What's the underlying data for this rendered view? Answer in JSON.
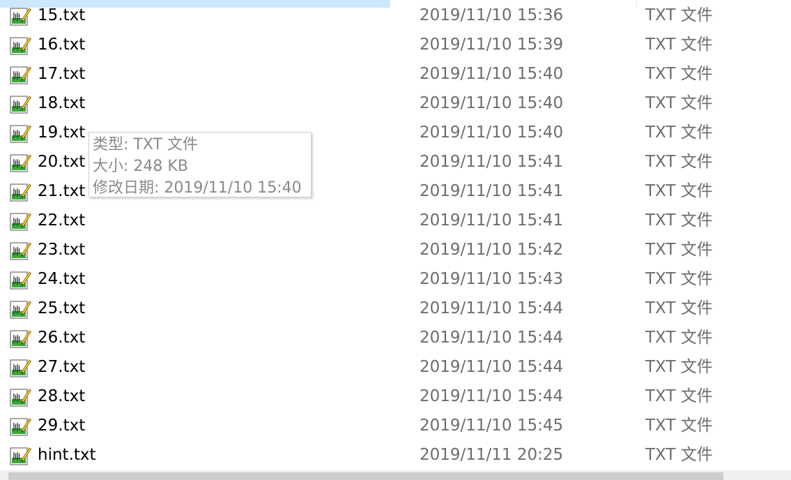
{
  "files": [
    {
      "name": "15.txt",
      "modified": "2019/11/10 15:36",
      "type": "TXT 文件"
    },
    {
      "name": "16.txt",
      "modified": "2019/11/10 15:39",
      "type": "TXT 文件"
    },
    {
      "name": "17.txt",
      "modified": "2019/11/10 15:40",
      "type": "TXT 文件"
    },
    {
      "name": "18.txt",
      "modified": "2019/11/10 15:40",
      "type": "TXT 文件"
    },
    {
      "name": "19.txt",
      "modified": "2019/11/10 15:40",
      "type": "TXT 文件"
    },
    {
      "name": "20.txt",
      "modified": "2019/11/10 15:41",
      "type": "TXT 文件"
    },
    {
      "name": "21.txt",
      "modified": "2019/11/10 15:41",
      "type": "TXT 文件"
    },
    {
      "name": "22.txt",
      "modified": "2019/11/10 15:41",
      "type": "TXT 文件"
    },
    {
      "name": "23.txt",
      "modified": "2019/11/10 15:42",
      "type": "TXT 文件"
    },
    {
      "name": "24.txt",
      "modified": "2019/11/10 15:43",
      "type": "TXT 文件"
    },
    {
      "name": "25.txt",
      "modified": "2019/11/10 15:44",
      "type": "TXT 文件"
    },
    {
      "name": "26.txt",
      "modified": "2019/11/10 15:44",
      "type": "TXT 文件"
    },
    {
      "name": "27.txt",
      "modified": "2019/11/10 15:44",
      "type": "TXT 文件"
    },
    {
      "name": "28.txt",
      "modified": "2019/11/10 15:44",
      "type": "TXT 文件"
    },
    {
      "name": "29.txt",
      "modified": "2019/11/10 15:45",
      "type": "TXT 文件"
    },
    {
      "name": "hint.txt",
      "modified": "2019/11/11 20:25",
      "type": "TXT 文件"
    }
  ],
  "tooltip": {
    "type_line": "类型: TXT 文件",
    "size_line": "大小: 248 KB",
    "modified_line": "修改日期: 2019/11/10 15:40"
  },
  "icons": {
    "file_icon": "notepad-txt-icon"
  },
  "colors": {
    "selection": "#cce8ff",
    "secondary_text": "#6d6d6d",
    "tooltip_text": "#8a8a8a",
    "icon_green": "#2e9a2e"
  }
}
